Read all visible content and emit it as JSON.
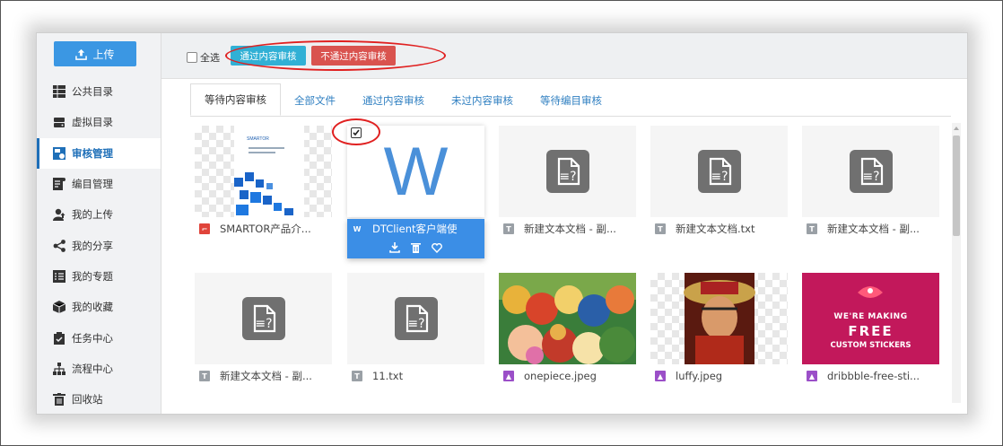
{
  "sidebar": {
    "upload_label": "上传",
    "items": [
      {
        "label": "公共目录",
        "icon": "grid-icon"
      },
      {
        "label": "虚拟目录",
        "icon": "drive-icon"
      },
      {
        "label": "审核管理",
        "icon": "review-icon",
        "active": true
      },
      {
        "label": "编目管理",
        "icon": "catalog-icon"
      },
      {
        "label": "我的上传",
        "icon": "user-upload-icon"
      },
      {
        "label": "我的分享",
        "icon": "share-icon"
      },
      {
        "label": "我的专题",
        "icon": "list-icon"
      },
      {
        "label": "我的收藏",
        "icon": "box-icon"
      },
      {
        "label": "任务中心",
        "icon": "clipboard-icon"
      },
      {
        "label": "流程中心",
        "icon": "sitemap-icon"
      },
      {
        "label": "回收站",
        "icon": "trash-icon"
      }
    ]
  },
  "toolbar": {
    "select_all_label": "全选",
    "pass_label": "通过内容审核",
    "fail_label": "不通过内容审核"
  },
  "tabs": [
    "等待内容审核",
    "全部文件",
    "通过内容审核",
    "未过内容审核",
    "等待编目审核"
  ],
  "active_tab": "等待内容审核",
  "files": [
    {
      "name": "SMARTOR产品介...",
      "type": "pdf"
    },
    {
      "name": "DTClient客户端使",
      "type": "word",
      "selected": true
    },
    {
      "name": "新建文本文档 - 副...",
      "type": "txt"
    },
    {
      "name": "新建文本文档.txt",
      "type": "txt"
    },
    {
      "name": "新建文本文档 - 副...",
      "type": "txt"
    },
    {
      "name": "新建文本文档 - 副...",
      "type": "txt"
    },
    {
      "name": "11.txt",
      "type": "txt"
    },
    {
      "name": "onepiece.jpeg",
      "type": "image"
    },
    {
      "name": "luffy.jpeg",
      "type": "image"
    },
    {
      "name": "dribbble-free-sti...",
      "type": "image"
    }
  ],
  "thumbs": {
    "word_letter": "W",
    "sticker_line1": "WE'RE MAKING",
    "sticker_line2": "FREE",
    "sticker_line3": "CUSTOM STICKERS",
    "pdf_brand": "SMARTOR"
  },
  "colors": {
    "accent": "#3b8ee6",
    "pass": "#31b0d5",
    "fail": "#d9534f",
    "highlight": "#e02020",
    "sticker_bg": "#c2185b"
  }
}
